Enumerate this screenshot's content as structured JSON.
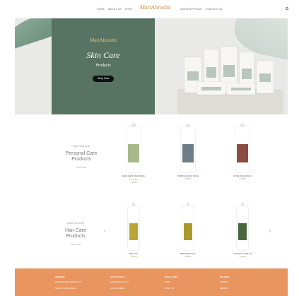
{
  "header": {
    "nav_left": [
      "HOME",
      "ABOUT US",
      "SHOP"
    ],
    "logo": "MariAbrushti",
    "logo_tag": "",
    "nav_right": [
      "SUBSCRIPTIONS",
      "CONTACT US"
    ]
  },
  "hero": {
    "logo": "MariAbrushti",
    "title": "Skin Care",
    "subtitle": "Products",
    "cta": "Shop Now",
    "slides": 5,
    "active_slide": 1
  },
  "sections": [
    {
      "brand": "Mari Shrushti",
      "title_line1": "Personal Care",
      "title_line2": "Products",
      "link": "VIEW MORE",
      "products": [
        {
          "name": "ALOE VERA FACE WASH",
          "price": "₹ 00.00",
          "stars": "★★★★★",
          "color": "#a8b98a"
        },
        {
          "name": "MORINGA HAIR WASH",
          "price": "₹ 00.00",
          "stars": "",
          "color": "#6f7e86"
        },
        {
          "name": "ROSE FACE WASH",
          "price": "₹ 00.00",
          "stars": "",
          "color": "#8a4d44"
        }
      ]
    },
    {
      "brand": "Mari Shrushti",
      "title_line1": "Hair Care",
      "title_line2": "Products",
      "link": "VIEW MORE",
      "products": [
        {
          "name": "AMLA OIL",
          "price": "₹ 00.00",
          "stars": "",
          "color": "#b9a53a"
        },
        {
          "name": "BHRINGRAJ OIL",
          "price": "₹ 00.00",
          "stars": "",
          "color": "#a99a2e"
        },
        {
          "name": "COCONUT HAIR OIL",
          "price": "₹ 00.00",
          "stars": "",
          "color": "#4a6640"
        }
      ]
    }
  ],
  "footer": {
    "col1_title": "ADDRESS",
    "col1_lines": [
      "MARI SHRUSHTI NATURE LLP",
      "SURAT, GUJARAT, INDIA"
    ],
    "col2_title": "GET IN TOUCH",
    "col2_lines": [
      "info@marishrushti.com",
      "+91 00000 00000"
    ],
    "col3_title": "QUICK LINKS",
    "col3_lines": [
      "SHOP",
      "ABOUT US"
    ],
    "col4_title": "POLICIES",
    "col4_lines": [
      "SHIPPING",
      "REFUND"
    ]
  },
  "colors": {
    "hero_panel": "#577363",
    "accent": "#c98a3a",
    "footer": "#e8955f"
  }
}
